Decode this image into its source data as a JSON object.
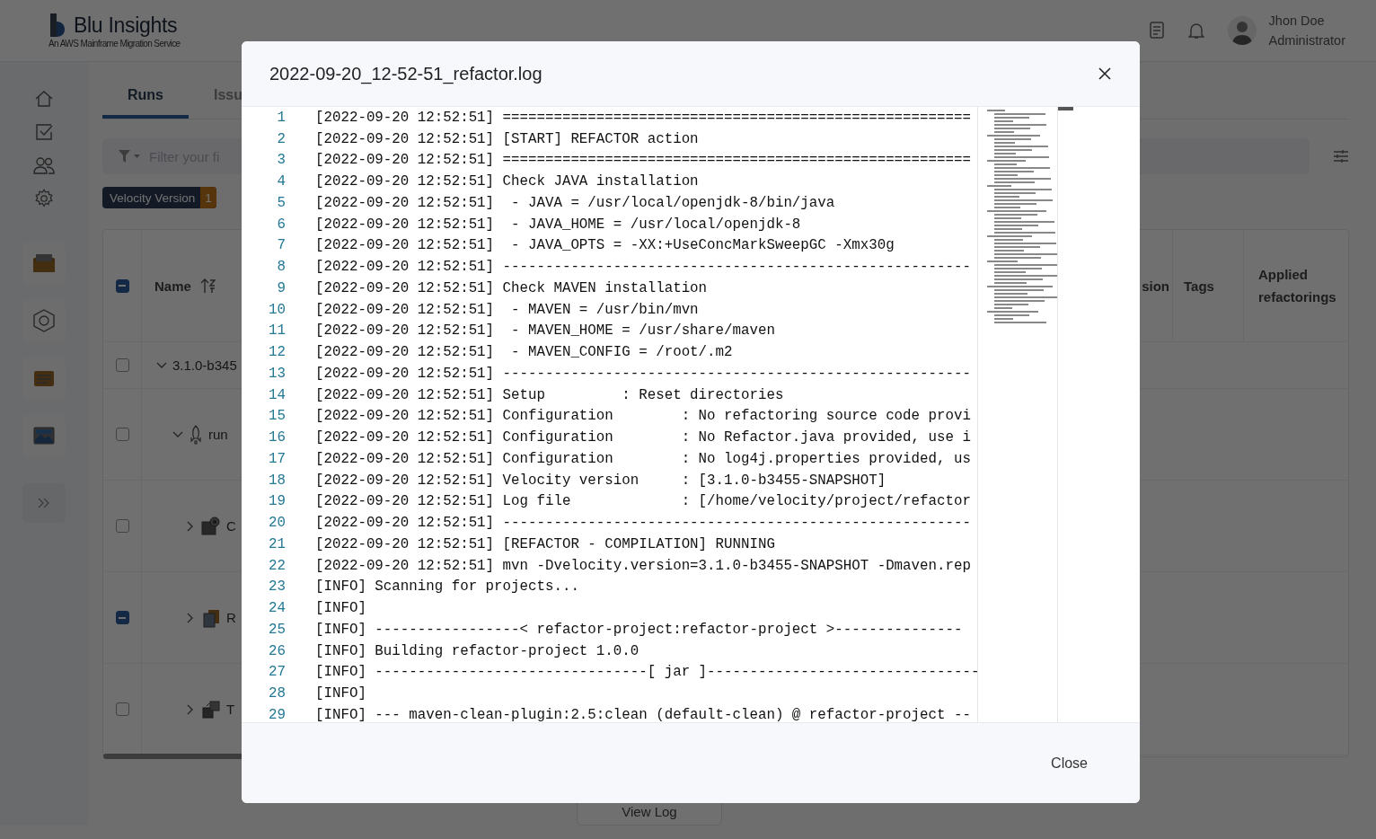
{
  "header": {
    "logo": {
      "title": "Blu Insights",
      "subtitle": "An AWS Mainframe Migration Service"
    },
    "user": {
      "name": "Jhon Doe",
      "role": "Administrator"
    }
  },
  "tabs": [
    {
      "label": "Runs",
      "selected": true
    },
    {
      "label": "Issu",
      "selected": false
    }
  ],
  "filter": {
    "placeholder": "Filter your fi"
  },
  "chips": [
    {
      "label": "Velocity Version",
      "count": "1"
    }
  ],
  "table": {
    "header_checked": true,
    "columns": [
      "Name",
      "sion",
      "Tags",
      "Applied refactorings"
    ],
    "rows": [
      {
        "name": "3.1.0-b345",
        "checked": false,
        "expanded": true,
        "children": [
          {
            "name": "run",
            "kind": "rocket",
            "checked": false,
            "expanded": true,
            "children": [
              {
                "name": "C",
                "kind": "gear-doc",
                "checked": false,
                "expanded": false
              },
              {
                "name": "R",
                "kind": "files",
                "checked": true,
                "expanded": false
              },
              {
                "name": "T",
                "kind": "transfer",
                "checked": false,
                "expanded": false
              }
            ]
          }
        ]
      }
    ]
  },
  "view_log": "View Log",
  "modal": {
    "title": "2022-09-20_12-52-51_refactor.log",
    "close_label": "Close",
    "lines": [
      {
        "number": "1",
        "text": "[2022-09-20 12:52:51] ======================================================="
      },
      {
        "number": "2",
        "text": "[2022-09-20 12:52:51] [START] REFACTOR action"
      },
      {
        "number": "3",
        "text": "[2022-09-20 12:52:51] ======================================================="
      },
      {
        "number": "4",
        "text": "[2022-09-20 12:52:51] Check JAVA installation"
      },
      {
        "number": "5",
        "text": "[2022-09-20 12:52:51]  - JAVA = /usr/local/openjdk-8/bin/java"
      },
      {
        "number": "6",
        "text": "[2022-09-20 12:52:51]  - JAVA_HOME = /usr/local/openjdk-8"
      },
      {
        "number": "7",
        "text": "[2022-09-20 12:52:51]  - JAVA_OPTS = -XX:+UseConcMarkSweepGC -Xmx30g"
      },
      {
        "number": "8",
        "text": "[2022-09-20 12:52:51] -------------------------------------------------------"
      },
      {
        "number": "9",
        "text": "[2022-09-20 12:52:51] Check MAVEN installation"
      },
      {
        "number": "10",
        "text": "[2022-09-20 12:52:51]  - MAVEN = /usr/bin/mvn"
      },
      {
        "number": "11",
        "text": "[2022-09-20 12:52:51]  - MAVEN_HOME = /usr/share/maven"
      },
      {
        "number": "12",
        "text": "[2022-09-20 12:52:51]  - MAVEN_CONFIG = /root/.m2"
      },
      {
        "number": "13",
        "text": "[2022-09-20 12:52:51] -------------------------------------------------------"
      },
      {
        "number": "14",
        "text": "[2022-09-20 12:52:51] Setup         : Reset directories"
      },
      {
        "number": "15",
        "text": "[2022-09-20 12:52:51] Configuration        : No refactoring source code provi"
      },
      {
        "number": "16",
        "text": "[2022-09-20 12:52:51] Configuration        : No Refactor.java provided, use i"
      },
      {
        "number": "17",
        "text": "[2022-09-20 12:52:51] Configuration        : No log4j.properties provided, us"
      },
      {
        "number": "18",
        "text": "[2022-09-20 12:52:51] Velocity version     : [3.1.0-b3455-SNAPSHOT]"
      },
      {
        "number": "19",
        "text": "[2022-09-20 12:52:51] Log file             : [/home/velocity/project/refactor"
      },
      {
        "number": "20",
        "text": "[2022-09-20 12:52:51] -------------------------------------------------------"
      },
      {
        "number": "21",
        "text": "[2022-09-20 12:52:51] [REFACTOR - COMPILATION] RUNNING"
      },
      {
        "number": "22",
        "text": "[2022-09-20 12:52:51] mvn -Dvelocity.version=3.1.0-b3455-SNAPSHOT -Dmaven.rep"
      },
      {
        "number": "23",
        "text": "[INFO] Scanning for projects..."
      },
      {
        "number": "24",
        "text": "[INFO]"
      },
      {
        "number": "25",
        "text": "[INFO] -----------------< refactor-project:refactor-project >---------------"
      },
      {
        "number": "26",
        "text": "[INFO] Building refactor-project 1.0.0"
      },
      {
        "number": "27",
        "text": "[INFO] --------------------------------[ jar ]--------------------------------"
      },
      {
        "number": "28",
        "text": "[INFO]"
      },
      {
        "number": "29",
        "text": "[INFO] --- maven-clean-plugin:2.5:clean (default-clean) @ refactor-project --"
      }
    ]
  }
}
